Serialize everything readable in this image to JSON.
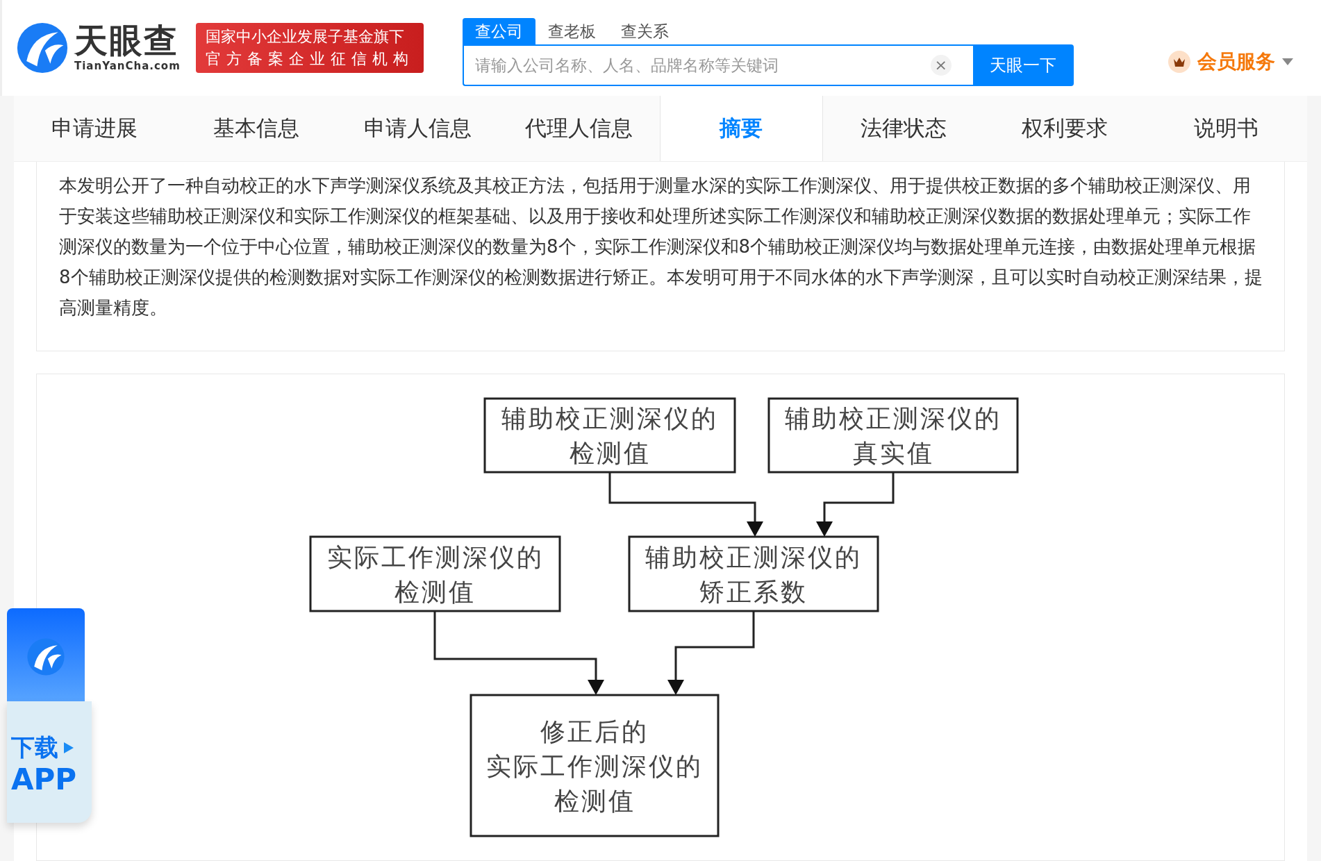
{
  "header": {
    "logo_text": "天眼查",
    "logo_domain": "TianYanCha.com",
    "badge_lines": [
      "国家中小企业发展子基金旗下",
      "官方备案企业征信机构"
    ],
    "search_tabs": [
      {
        "label": "查公司",
        "selected": true
      },
      {
        "label": "查老板",
        "selected": false
      },
      {
        "label": "查关系",
        "selected": false
      }
    ],
    "search": {
      "placeholder": "请输入公司名称、人名、品牌名称等关键词",
      "clear": "×",
      "button": "天眼一下"
    },
    "vip": "会员服务"
  },
  "nav_tabs": [
    {
      "label": "申请进展",
      "selected": false
    },
    {
      "label": "基本信息",
      "selected": false
    },
    {
      "label": "申请人信息",
      "selected": false
    },
    {
      "label": "代理人信息",
      "selected": false
    },
    {
      "label": "摘要",
      "selected": true
    },
    {
      "label": "法律状态",
      "selected": false
    },
    {
      "label": "权利要求",
      "selected": false
    },
    {
      "label": "说明书",
      "selected": false
    }
  ],
  "abstract": "本发明公开了一种自动校正的水下声学测深仪系统及其校正方法，包括用于测量水深的实际工作测深仪、用于提供校正数据的多个辅助校正测深仪、用于安装这些辅助校正测深仪和实际工作测深仪的框架基础、以及用于接收和处理所述实际工作测深仪和辅助校正测深仪数据的数据处理单元；实际工作测深仪的数量为一个位于中心位置，辅助校正测深仪的数量为8个，实际工作测深仪和8个辅助校正测深仪均与数据处理单元连接，由数据处理单元根据8个辅助校正测深仪提供的检测数据对实际工作测深仪的检测数据进行矫正。本发明可用于不同水体的水下声学测深，且可以实时自动校正测深结果，提高测量精度。",
  "flowchart": {
    "nodes": [
      {
        "lines": [
          "辅助校正测深仪的",
          "检测值"
        ]
      },
      {
        "lines": [
          "辅助校正测深仪的",
          "真实值"
        ]
      },
      {
        "lines": [
          "实际工作测深仪的",
          "检测值"
        ]
      },
      {
        "lines": [
          "辅助校正测深仪的",
          "矫正系数"
        ]
      },
      {
        "lines": [
          "修正后的",
          "实际工作测深仪的",
          "检测值"
        ]
      }
    ]
  },
  "download_widget": {
    "line1": "下载",
    "line2": "APP"
  }
}
